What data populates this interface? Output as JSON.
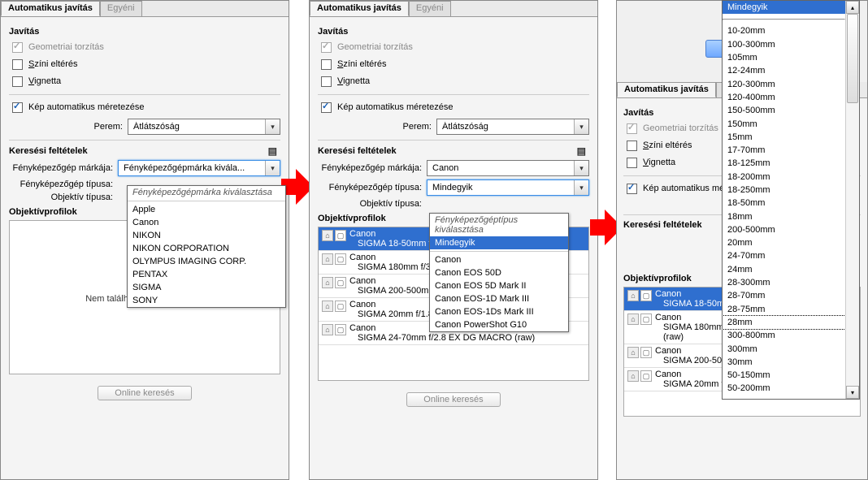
{
  "tabs": {
    "auto": "Automatikus javítás",
    "custom": "Egyéni"
  },
  "correction": {
    "title": "Javítás",
    "geometric": "Geometriai torzítás",
    "chromatic": "Színi eltérés",
    "vignette": "Vignetta"
  },
  "auto_resize": "Kép automatikus méretezése",
  "border": {
    "label": "Perem:",
    "value": "Átlátszóság"
  },
  "search": {
    "title": "Keresési feltételek",
    "camera_make_label": "Fényképezőgép márkája:",
    "camera_type_label": "Fényképezőgép típusa:",
    "lens_type_label": "Objektív típusa:"
  },
  "panel1": {
    "make_value": "Fényképezőgépmárka kivála...",
    "make_prompt": "Fényképezőgépmárka kiválasztása",
    "makes": [
      "Apple",
      "Canon",
      "NIKON",
      "NIKON CORPORATION",
      "OLYMPUS IMAGING CORP.",
      "PENTAX",
      "SIGMA",
      "SONY"
    ],
    "profiles_title": "Objektívprofilok",
    "notfound": "Nem található megfelelő profil"
  },
  "panel2": {
    "make_value": "Canon",
    "type_value": "Mindegyik",
    "type_prompt": "Fényképezőgéptípus kiválasztása",
    "types": [
      "Mindegyik",
      "Canon",
      "Canon EOS 50D",
      "Canon EOS 5D Mark II",
      "Canon EOS-1D Mark III",
      "Canon EOS-1Ds Mark III",
      "Canon PowerShot G10"
    ],
    "profiles_title": "Objektívprofilok",
    "profiles": [
      {
        "make": "Canon",
        "lens": "SIGMA 18-50mm f/2.8-4.",
        "selected": true
      },
      {
        "make": "Canon",
        "lens": "SIGMA 180mm f/3.5 APO"
      },
      {
        "make": "Canon",
        "lens": "SIGMA 200-500mm f/2.8 APO EX DG  (raw)"
      },
      {
        "make": "Canon",
        "lens": "SIGMA 20mm f/1.8 EX DG AS RF  (raw)"
      },
      {
        "make": "Canon",
        "lens": "SIGMA 24-70mm f/2.8 EX DG MACRO  (raw)"
      }
    ]
  },
  "panel3": {
    "lens_selected": "Mindegyik",
    "lenses": [
      "Mindegyik",
      "10-20mm",
      "100-300mm",
      "105mm",
      "12-24mm",
      "120-300mm",
      "120-400mm",
      "150-500mm",
      "150mm",
      "15mm",
      "17-70mm",
      "18-125mm",
      "18-200mm",
      "18-250mm",
      "18-50mm",
      "18mm",
      "200-500mm",
      "20mm",
      "24-70mm",
      "24mm",
      "28-300mm",
      "28-70mm",
      "28-75mm",
      "28mm",
      "300-800mm",
      "300mm",
      "30mm",
      "50-150mm",
      "50-200mm"
    ],
    "lens_boxed": "28mm",
    "profiles_title": "Objektívprofilok",
    "profiles": [
      {
        "make": "Canon",
        "lens": "SIGMA 18-50mm f/2.8-4.",
        "selected": true
      },
      {
        "make": "Canon",
        "lens": "SIGMA 180mm f/3.5 APO MACRO EX DG HSM  (raw)"
      },
      {
        "make": "Canon",
        "lens": "SIGMA 200-500mm f/2.8 APO EX DG  (raw)"
      },
      {
        "make": "Canon",
        "lens": "SIGMA 20mm f/1.8 EX DG AS RF  (raw)"
      }
    ]
  },
  "online_search": "Online keresés"
}
